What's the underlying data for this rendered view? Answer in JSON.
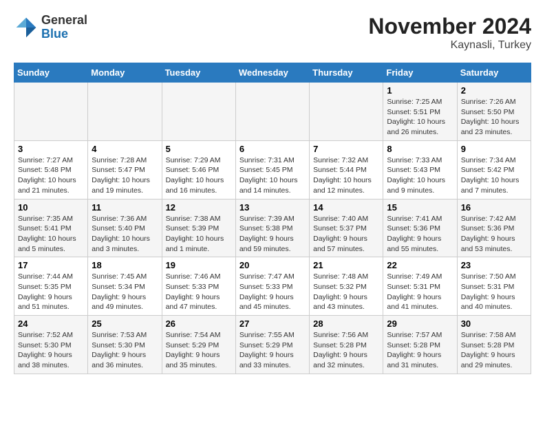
{
  "logo": {
    "general": "General",
    "blue": "Blue"
  },
  "title": "November 2024",
  "subtitle": "Kaynasli, Turkey",
  "weekdays": [
    "Sunday",
    "Monday",
    "Tuesday",
    "Wednesday",
    "Thursday",
    "Friday",
    "Saturday"
  ],
  "weeks": [
    [
      {
        "day": "",
        "info": ""
      },
      {
        "day": "",
        "info": ""
      },
      {
        "day": "",
        "info": ""
      },
      {
        "day": "",
        "info": ""
      },
      {
        "day": "",
        "info": ""
      },
      {
        "day": "1",
        "info": "Sunrise: 7:25 AM\nSunset: 5:51 PM\nDaylight: 10 hours and 26 minutes."
      },
      {
        "day": "2",
        "info": "Sunrise: 7:26 AM\nSunset: 5:50 PM\nDaylight: 10 hours and 23 minutes."
      }
    ],
    [
      {
        "day": "3",
        "info": "Sunrise: 7:27 AM\nSunset: 5:48 PM\nDaylight: 10 hours and 21 minutes."
      },
      {
        "day": "4",
        "info": "Sunrise: 7:28 AM\nSunset: 5:47 PM\nDaylight: 10 hours and 19 minutes."
      },
      {
        "day": "5",
        "info": "Sunrise: 7:29 AM\nSunset: 5:46 PM\nDaylight: 10 hours and 16 minutes."
      },
      {
        "day": "6",
        "info": "Sunrise: 7:31 AM\nSunset: 5:45 PM\nDaylight: 10 hours and 14 minutes."
      },
      {
        "day": "7",
        "info": "Sunrise: 7:32 AM\nSunset: 5:44 PM\nDaylight: 10 hours and 12 minutes."
      },
      {
        "day": "8",
        "info": "Sunrise: 7:33 AM\nSunset: 5:43 PM\nDaylight: 10 hours and 9 minutes."
      },
      {
        "day": "9",
        "info": "Sunrise: 7:34 AM\nSunset: 5:42 PM\nDaylight: 10 hours and 7 minutes."
      }
    ],
    [
      {
        "day": "10",
        "info": "Sunrise: 7:35 AM\nSunset: 5:41 PM\nDaylight: 10 hours and 5 minutes."
      },
      {
        "day": "11",
        "info": "Sunrise: 7:36 AM\nSunset: 5:40 PM\nDaylight: 10 hours and 3 minutes."
      },
      {
        "day": "12",
        "info": "Sunrise: 7:38 AM\nSunset: 5:39 PM\nDaylight: 10 hours and 1 minute."
      },
      {
        "day": "13",
        "info": "Sunrise: 7:39 AM\nSunset: 5:38 PM\nDaylight: 9 hours and 59 minutes."
      },
      {
        "day": "14",
        "info": "Sunrise: 7:40 AM\nSunset: 5:37 PM\nDaylight: 9 hours and 57 minutes."
      },
      {
        "day": "15",
        "info": "Sunrise: 7:41 AM\nSunset: 5:36 PM\nDaylight: 9 hours and 55 minutes."
      },
      {
        "day": "16",
        "info": "Sunrise: 7:42 AM\nSunset: 5:36 PM\nDaylight: 9 hours and 53 minutes."
      }
    ],
    [
      {
        "day": "17",
        "info": "Sunrise: 7:44 AM\nSunset: 5:35 PM\nDaylight: 9 hours and 51 minutes."
      },
      {
        "day": "18",
        "info": "Sunrise: 7:45 AM\nSunset: 5:34 PM\nDaylight: 9 hours and 49 minutes."
      },
      {
        "day": "19",
        "info": "Sunrise: 7:46 AM\nSunset: 5:33 PM\nDaylight: 9 hours and 47 minutes."
      },
      {
        "day": "20",
        "info": "Sunrise: 7:47 AM\nSunset: 5:33 PM\nDaylight: 9 hours and 45 minutes."
      },
      {
        "day": "21",
        "info": "Sunrise: 7:48 AM\nSunset: 5:32 PM\nDaylight: 9 hours and 43 minutes."
      },
      {
        "day": "22",
        "info": "Sunrise: 7:49 AM\nSunset: 5:31 PM\nDaylight: 9 hours and 41 minutes."
      },
      {
        "day": "23",
        "info": "Sunrise: 7:50 AM\nSunset: 5:31 PM\nDaylight: 9 hours and 40 minutes."
      }
    ],
    [
      {
        "day": "24",
        "info": "Sunrise: 7:52 AM\nSunset: 5:30 PM\nDaylight: 9 hours and 38 minutes."
      },
      {
        "day": "25",
        "info": "Sunrise: 7:53 AM\nSunset: 5:30 PM\nDaylight: 9 hours and 36 minutes."
      },
      {
        "day": "26",
        "info": "Sunrise: 7:54 AM\nSunset: 5:29 PM\nDaylight: 9 hours and 35 minutes."
      },
      {
        "day": "27",
        "info": "Sunrise: 7:55 AM\nSunset: 5:29 PM\nDaylight: 9 hours and 33 minutes."
      },
      {
        "day": "28",
        "info": "Sunrise: 7:56 AM\nSunset: 5:28 PM\nDaylight: 9 hours and 32 minutes."
      },
      {
        "day": "29",
        "info": "Sunrise: 7:57 AM\nSunset: 5:28 PM\nDaylight: 9 hours and 31 minutes."
      },
      {
        "day": "30",
        "info": "Sunrise: 7:58 AM\nSunset: 5:28 PM\nDaylight: 9 hours and 29 minutes."
      }
    ]
  ]
}
